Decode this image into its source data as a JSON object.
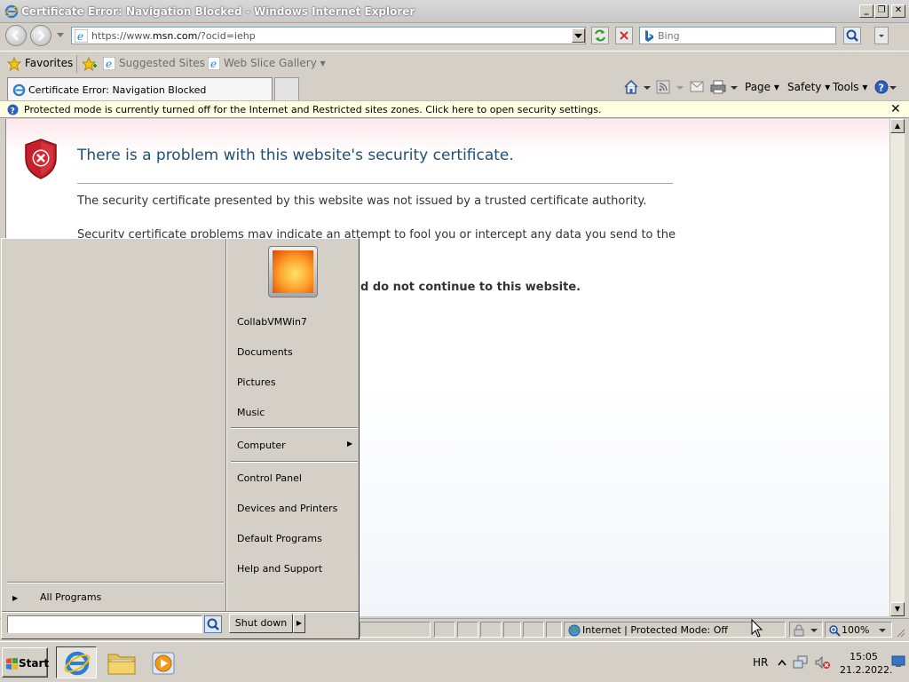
{
  "window": {
    "title": "Certificate Error: Navigation Blocked - Windows Internet Explorer",
    "minimize_glyph": "_",
    "maximize_glyph": "❐",
    "close_glyph": "✕"
  },
  "address_bar": {
    "url_prefix": "https://www.",
    "url_host": "msn.com",
    "url_suffix": "/?ocid=iehp",
    "search_placeholder": "Bing"
  },
  "favorites_bar": {
    "favorites_label": "Favorites",
    "suggested_sites_label": "Suggested Sites ▾",
    "web_slice_label": "Web Slice Gallery ▾"
  },
  "tabs": {
    "active_label": "Certificate Error: Navigation Blocked"
  },
  "command_bar": {
    "page_label": "Page ▾",
    "safety_label": "Safety ▾",
    "tools_label": "Tools ▾"
  },
  "info_bar": {
    "text": "Protected mode is currently turned off for the Internet and Restricted sites zones.  Click here to open security settings.",
    "close_glyph": "✕"
  },
  "content": {
    "heading": "There is a problem with this website's security certificate.",
    "paragraph1": "The security certificate presented by this website was not issued by a trusted certificate authority.",
    "paragraph2": "Security certificate problems may indicate an attempt to fool you or intercept any data you send to the",
    "paragraph3": "d do not continue to this website."
  },
  "status_bar": {
    "zone_text": "Internet | Protected Mode: Off",
    "zoom_text": "100%"
  },
  "start_menu": {
    "user_name": "CollabVMWin7",
    "right_items_group1": [
      "Documents",
      "Pictures",
      "Music"
    ],
    "computer_label": "Computer",
    "right_items_group2": [
      "Control Panel",
      "Devices and Printers",
      "Default Programs",
      "Help and Support"
    ],
    "all_programs_label": "All Programs",
    "shutdown_label": "Shut down"
  },
  "taskbar": {
    "start_label": "Start",
    "language": "HR",
    "time": "15:05",
    "date": "21.2.2022."
  },
  "colors": {
    "heading_blue": "#1f4e79",
    "info_bar_yellow": "#ffffe1",
    "shield_red": "#c8202a"
  }
}
